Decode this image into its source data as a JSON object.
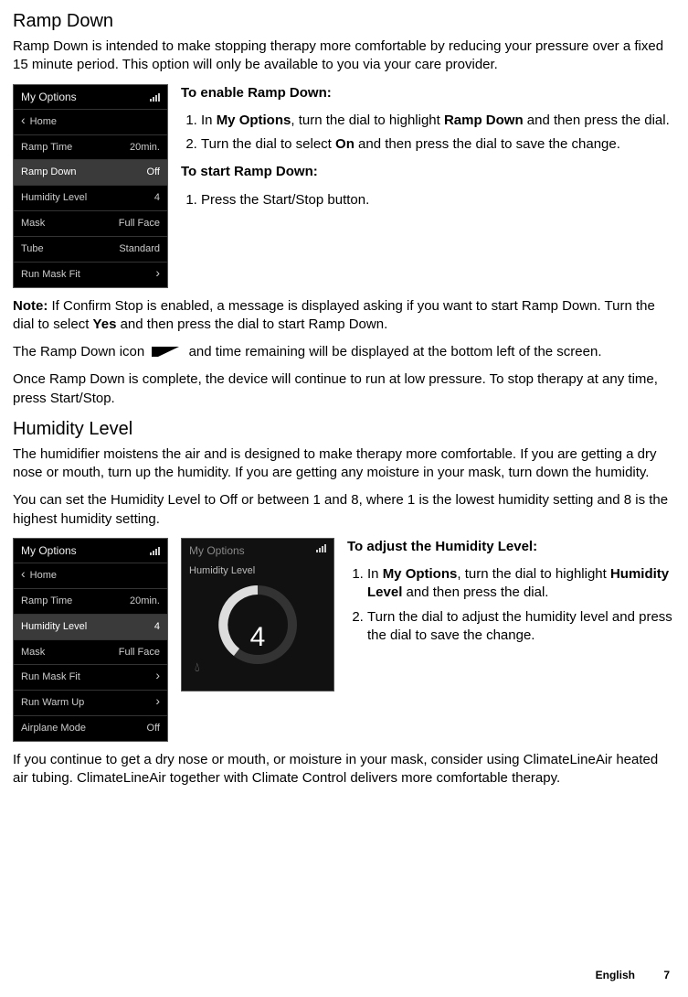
{
  "sections": {
    "rampDown": {
      "title": "Ramp Down",
      "intro": "Ramp Down is intended to make stopping therapy more comfortable by reducing your pressure over a fixed 15 minute period. This option will only be available to you via your care provider.",
      "enableHeading": "To enable Ramp Down:",
      "enableStep1_pre": "In ",
      "enableStep1_bold1": "My Options",
      "enableStep1_mid": ", turn the dial to highlight ",
      "enableStep1_bold2": "Ramp Down",
      "enableStep1_post": " and then press the dial.",
      "enableStep2_pre": "Turn the dial to select ",
      "enableStep2_bold": "On",
      "enableStep2_post": " and then press the dial to save the change.",
      "startHeading": "To start Ramp Down:",
      "startStep1": "Press the Start/Stop button.",
      "note_bold": "Note:",
      "note_pre": " If Confirm Stop is enabled, a message is displayed asking if you want to start Ramp Down. Turn the dial to select ",
      "note_yes": "Yes",
      "note_post": " and then press the dial to start Ramp Down.",
      "iconLine_pre": "The Ramp Down icon ",
      "iconLine_post": " and time remaining will be displayed at the bottom left of the screen.",
      "completeLine": "Once Ramp Down is complete, the device will continue to run at low pressure. To stop therapy at any time, press Start/Stop."
    },
    "humidity": {
      "title": "Humidity Level",
      "intro": "The humidifier moistens the air and is designed to make therapy more comfortable. If you are getting a dry nose or mouth, turn up the humidity. If you are getting any moisture in your mask, turn down the humidity.",
      "range": "You can set the Humidity Level to Off or between 1 and 8, where 1 is the lowest humidity setting and 8 is the highest humidity setting.",
      "adjustHeading": "To adjust the Humidity Level:",
      "adjustStep1_pre": "In ",
      "adjustStep1_bold1": "My Options",
      "adjustStep1_mid": ", turn the dial to highlight ",
      "adjustStep1_bold2": "Humidity Level",
      "adjustStep1_post": " and then press the dial.",
      "adjustStep2": "Turn the dial to adjust the humidity level and press the dial to save the change.",
      "outro": "If you continue to get a dry nose or mouth, or moisture in your mask, consider using ClimateLineAir heated air tubing. ClimateLineAir together with Climate Control delivers more comfortable therapy."
    }
  },
  "screens": {
    "menu1": {
      "title": "My Options",
      "rows": [
        {
          "label": "Home",
          "value": "",
          "chevLeft": true
        },
        {
          "label": "Ramp Time",
          "value": "20min."
        },
        {
          "label": "Ramp Down",
          "value": "Off",
          "highlight": true
        },
        {
          "label": "Humidity Level",
          "value": "4"
        },
        {
          "label": "Mask",
          "value": "Full Face"
        },
        {
          "label": "Tube",
          "value": "Standard"
        },
        {
          "label": "Run Mask Fit",
          "value": "",
          "chevRight": true
        }
      ]
    },
    "menu2": {
      "title": "My Options",
      "rows": [
        {
          "label": "Home",
          "value": "",
          "chevLeft": true
        },
        {
          "label": "Ramp Time",
          "value": "20min."
        },
        {
          "label": "Humidity Level",
          "value": "4",
          "highlight": true
        },
        {
          "label": "Mask",
          "value": "Full Face"
        },
        {
          "label": "Run Mask Fit",
          "value": "",
          "chevRight": true
        },
        {
          "label": "Run Warm Up",
          "value": "",
          "chevRight": true
        },
        {
          "label": "Airplane Mode",
          "value": "Off"
        }
      ]
    },
    "dial": {
      "title": "My Options",
      "label": "Humidity Level",
      "value": "4"
    }
  },
  "footer": {
    "lang": "English",
    "page": "7"
  }
}
